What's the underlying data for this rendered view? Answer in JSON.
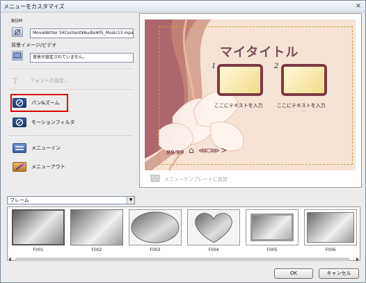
{
  "window": {
    "title": "メニューをカスタマイズ",
    "close_glyph": "×"
  },
  "bgm": {
    "label": "BGM",
    "path": "MovieWriter 5¥Content¥Audio¥05_Music13.mpa"
  },
  "bg": {
    "label": "背景イメージ/ビデオ",
    "value": "背景が設定されていません。"
  },
  "font": {
    "label": "フォントの設定..."
  },
  "tools": {
    "pan": "パン&ズーム",
    "motion": "モーションフィルタ",
    "menuin": "メニューイン",
    "menuout": "メニューアウト"
  },
  "preview": {
    "title": "マイタイトル",
    "items": [
      {
        "num": "1",
        "label": "ここにテキストを入力"
      },
      {
        "num": "2",
        "label": "ここにテキストを入力"
      }
    ],
    "ellipsis": "...",
    "page": "99/99",
    "add_template": "メニューテンプレートに追加"
  },
  "frame_select": {
    "value": "フレーム"
  },
  "frames": [
    "F001",
    "F002",
    "F003",
    "F004",
    "F005",
    "F006"
  ],
  "buttons": {
    "ok": "OK",
    "cancel": "キャンセル"
  },
  "colors": {
    "highlight": "#e00000",
    "frame_border": "#7c3a43"
  }
}
